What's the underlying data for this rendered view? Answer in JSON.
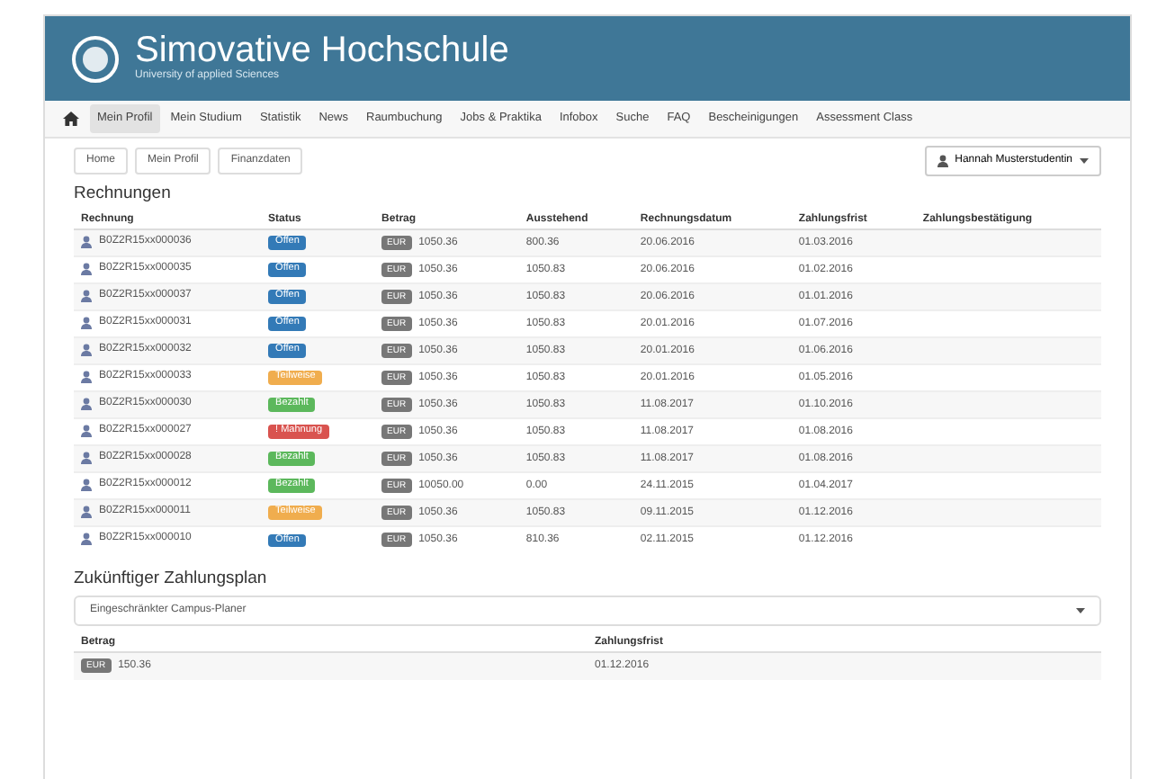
{
  "header": {
    "title": "Simovative  Hochschule",
    "subtitle": "University of applied Sciences"
  },
  "nav": [
    {
      "label": "Mein Profil",
      "selected": true
    },
    {
      "label": "Mein Studium",
      "selected": false
    },
    {
      "label": "Statistik",
      "selected": false
    },
    {
      "label": "News",
      "selected": false
    },
    {
      "label": "Raumbuchung",
      "selected": false
    },
    {
      "label": "Jobs & Praktika",
      "selected": false
    },
    {
      "label": "Infobox",
      "selected": false
    },
    {
      "label": "Suche",
      "selected": false
    },
    {
      "label": "FAQ",
      "selected": false
    },
    {
      "label": "Bescheinigungen",
      "selected": false
    },
    {
      "label": "Assessment Class",
      "selected": false
    }
  ],
  "breadcrumb": [
    "Home",
    "Mein Profil",
    "Finanzdaten"
  ],
  "user_menu": {
    "label": "Hannah Musterstudentin"
  },
  "invoices": {
    "title": "Rechnungen",
    "columns": [
      "Rechnung",
      "Status",
      "Betrag",
      "Ausstehend",
      "Rechnungsdatum",
      "Zahlungsfrist",
      "Zahlungsbestätigung"
    ],
    "rows": [
      {
        "number": "B0Z2R15xx000036",
        "status": "Offen",
        "kind": "open",
        "currency": "EUR",
        "amount": "1050.36",
        "outstanding": "800.36",
        "date": "20.06.2016",
        "due": "01.03.2016"
      },
      {
        "number": "B0Z2R15xx000035",
        "status": "Offen",
        "kind": "open",
        "currency": "EUR",
        "amount": "1050.36",
        "outstanding": "1050.83",
        "date": "20.06.2016",
        "due": "01.02.2016"
      },
      {
        "number": "B0Z2R15xx000037",
        "status": "Offen",
        "kind": "open",
        "currency": "EUR",
        "amount": "1050.36",
        "outstanding": "1050.83",
        "date": "20.06.2016",
        "due": "01.01.2016"
      },
      {
        "number": "B0Z2R15xx000031",
        "status": "Offen",
        "kind": "open",
        "currency": "EUR",
        "amount": "1050.36",
        "outstanding": "1050.83",
        "date": "20.01.2016",
        "due": "01.07.2016"
      },
      {
        "number": "B0Z2R15xx000032",
        "status": "Offen",
        "kind": "open",
        "currency": "EUR",
        "amount": "1050.36",
        "outstanding": "1050.83",
        "date": "20.01.2016",
        "due": "01.06.2016"
      },
      {
        "number": "B0Z2R15xx000033",
        "status": "Teilweise",
        "kind": "partial",
        "currency": "EUR",
        "amount": "1050.36",
        "outstanding": "1050.83",
        "date": "20.01.2016",
        "due": "01.05.2016"
      },
      {
        "number": "B0Z2R15xx000030",
        "status": "Bezahlt",
        "kind": "paid",
        "currency": "EUR",
        "amount": "1050.36",
        "outstanding": "1050.83",
        "date": "11.08.2017",
        "due": "01.10.2016"
      },
      {
        "number": "B0Z2R15xx000027",
        "status": "! Mahnung",
        "kind": "overdue",
        "currency": "EUR",
        "amount": "1050.36",
        "outstanding": "1050.83",
        "date": "11.08.2017",
        "due": "01.08.2016"
      },
      {
        "number": "B0Z2R15xx000028",
        "status": "Bezahlt",
        "kind": "paid",
        "currency": "EUR",
        "amount": "1050.36",
        "outstanding": "1050.83",
        "date": "11.08.2017",
        "due": "01.08.2016"
      },
      {
        "number": "B0Z2R15xx000012",
        "status": "Bezahlt",
        "kind": "paid",
        "currency": "EUR",
        "amount": "10050.00",
        "outstanding": "0.00",
        "date": "24.11.2015",
        "due": "01.04.2017"
      },
      {
        "number": "B0Z2R15xx000011",
        "status": "Teilweise",
        "kind": "partial",
        "currency": "EUR",
        "amount": "1050.36",
        "outstanding": "1050.83",
        "date": "09.11.2015",
        "due": "01.12.2016"
      },
      {
        "number": "B0Z2R15xx000010",
        "status": "Offen",
        "kind": "open",
        "currency": "EUR",
        "amount": "1050.36",
        "outstanding": "810.36",
        "date": "02.11.2015",
        "due": "01.12.2016"
      }
    ]
  },
  "plan": {
    "title": "Zukünftiger Zahlungsplan",
    "select": "Eingeschränkter Campus-Planer",
    "columns": [
      "Betrag",
      "Zahlungsfrist"
    ],
    "rows": [
      {
        "currency": "EUR",
        "amount": "150.36",
        "due": "01.12.2016"
      }
    ]
  }
}
